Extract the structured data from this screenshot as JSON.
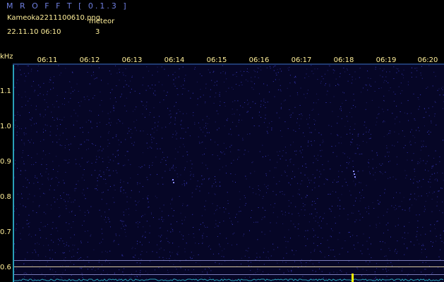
{
  "header": {
    "app_title": "M R O F F T  [ 0.1.3 ]",
    "file_name": "Kameoka2211100610.png",
    "meteor_label": "meteor",
    "datetime": "22.11.10 06:10",
    "meteor_count": "3"
  },
  "axis": {
    "y_unit": "kHz",
    "y_ticks": [
      "1.1",
      "1.0",
      "0.9",
      "0.8",
      "0.7",
      "0.6"
    ],
    "x_ticks": [
      "06:11",
      "06:12",
      "06:13",
      "06:14",
      "06:15",
      "06:16",
      "06:17",
      "06:18",
      "06:19",
      "06:20"
    ]
  },
  "colors": {
    "label_text": "#ffef9a",
    "title_text": "#6f7fe0",
    "background": "#000000",
    "spectrogram_bg": "#060626",
    "axis_bar": "#2aa0b8",
    "detection_spike": "#ffff00"
  }
}
